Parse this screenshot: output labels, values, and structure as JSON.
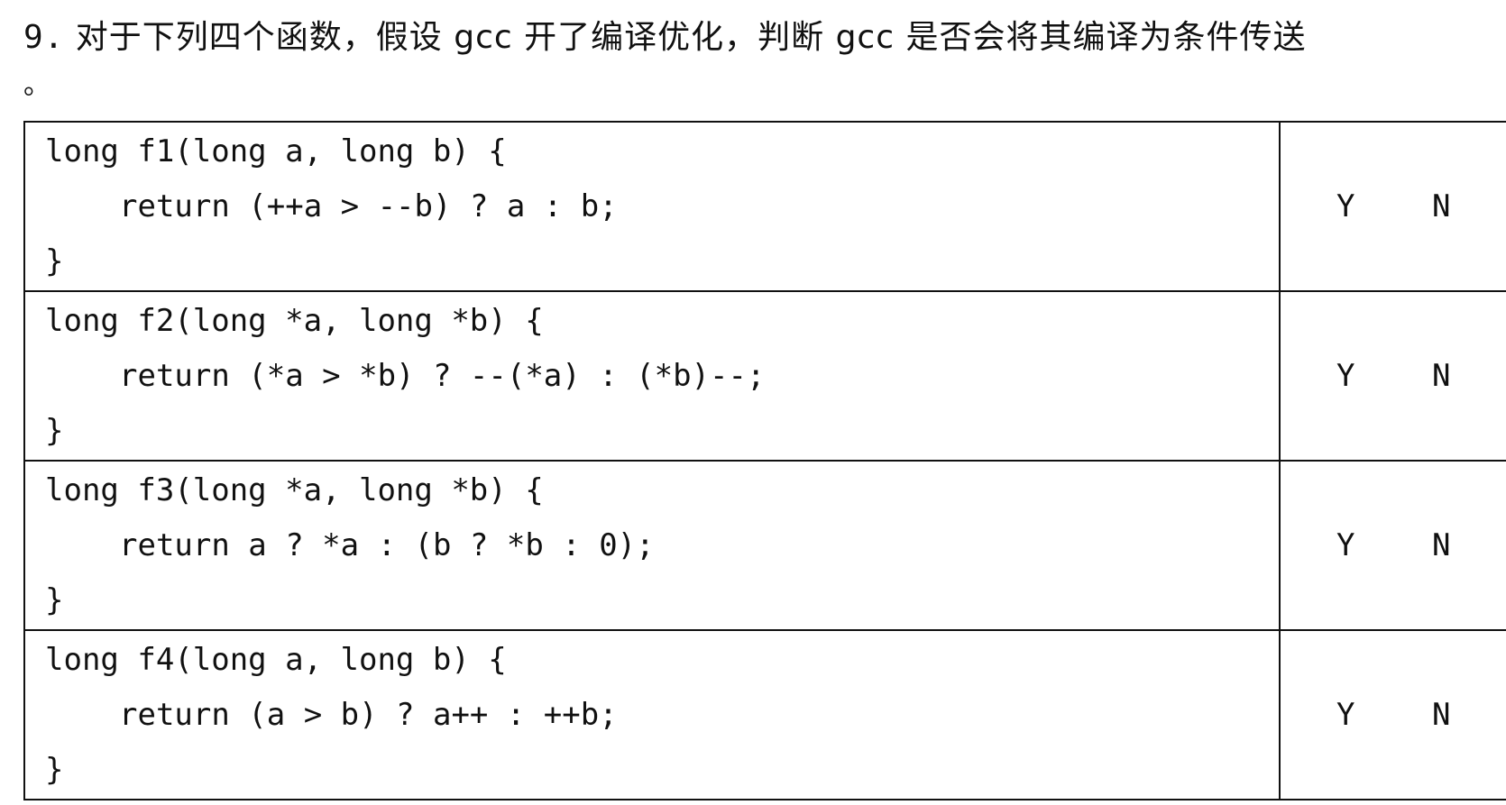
{
  "question": {
    "number": "9.",
    "text": " 对于下列四个函数，假设 gcc 开了编译优化，判断 gcc 是否会将其编译为条件传送",
    "trailing_mark": "。"
  },
  "rows": [
    {
      "signature": "long f1(long a, long b) {",
      "body": "return (++a > --b) ? a : b;",
      "closing": "}",
      "option_yes": "Y",
      "option_no": "N"
    },
    {
      "signature": "long f2(long *a, long *b) {",
      "body": "return (*a > *b) ? --(*a) : (*b)--;",
      "closing": "}",
      "option_yes": "Y",
      "option_no": "N"
    },
    {
      "signature": "long f3(long *a, long *b) {",
      "body": "return a ? *a : (b ? *b : 0);",
      "closing": "}",
      "option_yes": "Y",
      "option_no": "N"
    },
    {
      "signature": "long f4(long a, long b) {",
      "body": "return (a > b) ? a++ : ++b;",
      "closing": "}",
      "option_yes": "Y",
      "option_no": "N"
    }
  ]
}
